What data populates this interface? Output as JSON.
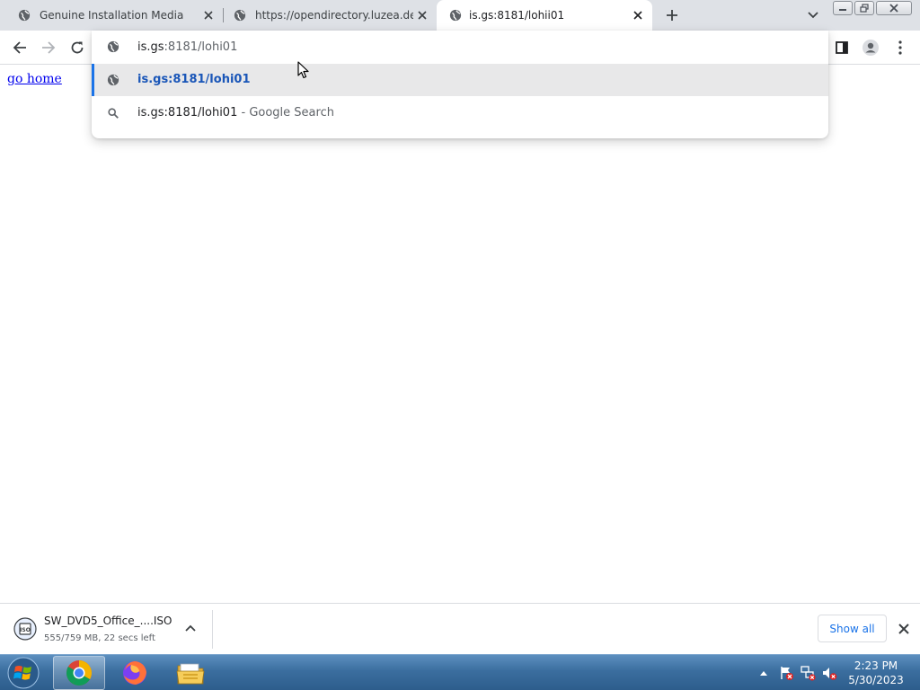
{
  "browser": {
    "tabs": [
      {
        "title": "Genuine Installation Media",
        "icon": "globe-icon",
        "active": false
      },
      {
        "title": "https://opendirectory.luzea.de/Er",
        "icon": "globe-icon",
        "active": false
      },
      {
        "title": "is.gs:8181/lohii01",
        "icon": "globe-icon",
        "active": true
      }
    ],
    "new_tab_icon": "plus-icon",
    "tab_search_icon": "chevron-down-icon"
  },
  "omnibox": {
    "input_typed": "is.gs",
    "input_autocomplete": ":8181/lohi01",
    "suggestions": [
      {
        "icon": "globe-icon",
        "text": "is.gs:8181/lohi01",
        "selected": true
      },
      {
        "icon": "search-icon",
        "text": "is.gs:8181/lohi01",
        "suffix": " - Google Search",
        "selected": false
      }
    ]
  },
  "page": {
    "link_text": "go home"
  },
  "download": {
    "filename": "SW_DVD5_Office_....ISO",
    "status": "555/759 MB, 22 secs left",
    "show_all_label": "Show all",
    "icon": "iso-file-icon"
  },
  "taskbar": {
    "apps": [
      "chrome-icon",
      "firefox-icon",
      "file-explorer-icon"
    ],
    "time": "2:23 PM",
    "date": "5/30/2023"
  },
  "colors": {
    "accent": "#1a73e8",
    "tabstrip": "#dee1e6",
    "link": "#0000ee"
  }
}
